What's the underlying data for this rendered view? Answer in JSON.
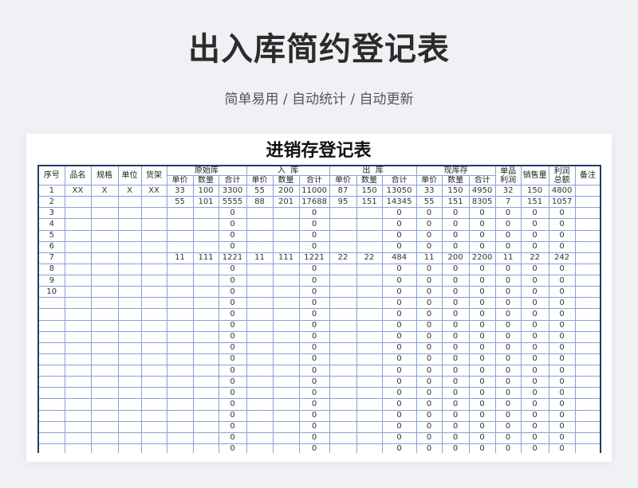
{
  "page": {
    "title": "出入库简约登记表",
    "subtitle": "简单易用 / 自动统计 / 自动更新"
  },
  "colors": {
    "page_bg": "#eff1f4",
    "title_color": "#2b2b2b",
    "subtitle_color": "#555555",
    "border_dark": "#203b6b",
    "grid_line": "#86a2d6"
  },
  "sheet": {
    "title": "进销存登记表",
    "header": {
      "seq": "序号",
      "name": "品名",
      "spec": "规格",
      "unit": "单位",
      "shelf": "货架",
      "groups": [
        "原始库",
        "入  库",
        "出  库",
        "现库存"
      ],
      "sub": [
        "单价",
        "数量",
        "合计"
      ],
      "unit_profit": "单品\n利润",
      "sales": "销售量",
      "total_profit": "利润\n总额",
      "note": "备注"
    },
    "rows": [
      [
        "1",
        "XX",
        "X",
        "X",
        "XX",
        "33",
        "100",
        "3300",
        "55",
        "200",
        "11000",
        "87",
        "150",
        "13050",
        "33",
        "150",
        "4950",
        "32",
        "150",
        "4800",
        ""
      ],
      [
        "2",
        "",
        "",
        "",
        "",
        "55",
        "101",
        "5555",
        "88",
        "201",
        "17688",
        "95",
        "151",
        "14345",
        "55",
        "151",
        "8305",
        "7",
        "151",
        "1057",
        ""
      ],
      [
        "3",
        "",
        "",
        "",
        "",
        "",
        "",
        "0",
        "",
        "",
        "0",
        "",
        "",
        "0",
        "0",
        "0",
        "0",
        "0",
        "0",
        "0",
        ""
      ],
      [
        "4",
        "",
        "",
        "",
        "",
        "",
        "",
        "0",
        "",
        "",
        "0",
        "",
        "",
        "0",
        "0",
        "0",
        "0",
        "0",
        "0",
        "0",
        ""
      ],
      [
        "5",
        "",
        "",
        "",
        "",
        "",
        "",
        "0",
        "",
        "",
        "0",
        "",
        "",
        "0",
        "0",
        "0",
        "0",
        "0",
        "0",
        "0",
        ""
      ],
      [
        "6",
        "",
        "",
        "",
        "",
        "",
        "",
        "0",
        "",
        "",
        "0",
        "",
        "",
        "0",
        "0",
        "0",
        "0",
        "0",
        "0",
        "0",
        ""
      ],
      [
        "7",
        "",
        "",
        "",
        "",
        "11",
        "111",
        "1221",
        "11",
        "111",
        "1221",
        "22",
        "22",
        "484",
        "11",
        "200",
        "2200",
        "11",
        "22",
        "242",
        ""
      ],
      [
        "8",
        "",
        "",
        "",
        "",
        "",
        "",
        "0",
        "",
        "",
        "0",
        "",
        "",
        "0",
        "0",
        "0",
        "0",
        "0",
        "0",
        "0",
        ""
      ],
      [
        "9",
        "",
        "",
        "",
        "",
        "",
        "",
        "0",
        "",
        "",
        "0",
        "",
        "",
        "0",
        "0",
        "0",
        "0",
        "0",
        "0",
        "0",
        ""
      ],
      [
        "10",
        "",
        "",
        "",
        "",
        "",
        "",
        "0",
        "",
        "",
        "0",
        "",
        "",
        "0",
        "0",
        "0",
        "0",
        "0",
        "0",
        "0",
        ""
      ],
      [
        "",
        "",
        "",
        "",
        "",
        "",
        "",
        "0",
        "",
        "",
        "0",
        "",
        "",
        "0",
        "0",
        "0",
        "0",
        "0",
        "0",
        "0",
        ""
      ],
      [
        "",
        "",
        "",
        "",
        "",
        "",
        "",
        "0",
        "",
        "",
        "0",
        "",
        "",
        "0",
        "0",
        "0",
        "0",
        "0",
        "0",
        "0",
        ""
      ],
      [
        "",
        "",
        "",
        "",
        "",
        "",
        "",
        "0",
        "",
        "",
        "0",
        "",
        "",
        "0",
        "0",
        "0",
        "0",
        "0",
        "0",
        "0",
        ""
      ],
      [
        "",
        "",
        "",
        "",
        "",
        "",
        "",
        "0",
        "",
        "",
        "0",
        "",
        "",
        "0",
        "0",
        "0",
        "0",
        "0",
        "0",
        "0",
        ""
      ],
      [
        "",
        "",
        "",
        "",
        "",
        "",
        "",
        "0",
        "",
        "",
        "0",
        "",
        "",
        "0",
        "0",
        "0",
        "0",
        "0",
        "0",
        "0",
        ""
      ],
      [
        "",
        "",
        "",
        "",
        "",
        "",
        "",
        "0",
        "",
        "",
        "0",
        "",
        "",
        "0",
        "0",
        "0",
        "0",
        "0",
        "0",
        "0",
        ""
      ],
      [
        "",
        "",
        "",
        "",
        "",
        "",
        "",
        "0",
        "",
        "",
        "0",
        "",
        "",
        "0",
        "0",
        "0",
        "0",
        "0",
        "0",
        "0",
        ""
      ],
      [
        "",
        "",
        "",
        "",
        "",
        "",
        "",
        "0",
        "",
        "",
        "0",
        "",
        "",
        "0",
        "0",
        "0",
        "0",
        "0",
        "0",
        "0",
        ""
      ],
      [
        "",
        "",
        "",
        "",
        "",
        "",
        "",
        "0",
        "",
        "",
        "0",
        "",
        "",
        "0",
        "0",
        "0",
        "0",
        "0",
        "0",
        "0",
        ""
      ],
      [
        "",
        "",
        "",
        "",
        "",
        "",
        "",
        "0",
        "",
        "",
        "0",
        "",
        "",
        "0",
        "0",
        "0",
        "0",
        "0",
        "0",
        "0",
        ""
      ],
      [
        "",
        "",
        "",
        "",
        "",
        "",
        "",
        "0",
        "",
        "",
        "0",
        "",
        "",
        "0",
        "0",
        "0",
        "0",
        "0",
        "0",
        "0",
        ""
      ],
      [
        "",
        "",
        "",
        "",
        "",
        "",
        "",
        "0",
        "",
        "",
        "0",
        "",
        "",
        "0",
        "0",
        "0",
        "0",
        "0",
        "0",
        "0",
        ""
      ],
      [
        "",
        "",
        "",
        "",
        "",
        "",
        "",
        "0",
        "",
        "",
        "0",
        "",
        "",
        "0",
        "0",
        "0",
        "0",
        "0",
        "0",
        "0",
        ""
      ],
      [
        "",
        "",
        "",
        "",
        "",
        "",
        "",
        "0",
        "",
        "",
        "0",
        "",
        "",
        "0",
        "0",
        "0",
        "0",
        "0",
        "0",
        "0",
        ""
      ]
    ]
  }
}
